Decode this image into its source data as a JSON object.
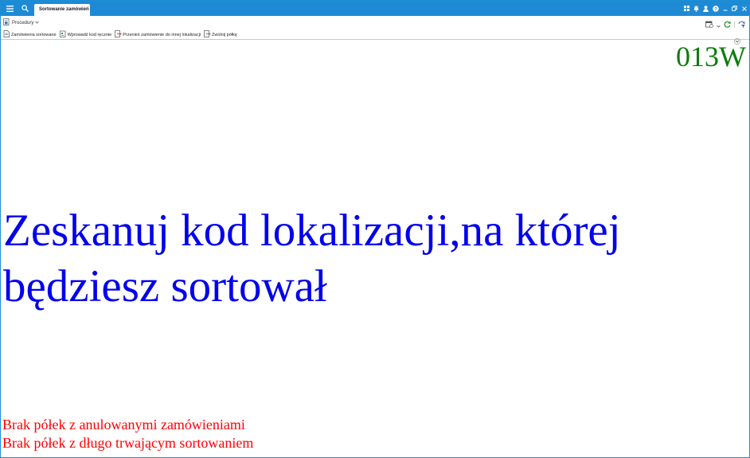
{
  "titlebar": {
    "tab_label": "Sortowanie zamówień",
    "icons": [
      "menu-icon",
      "search-icon",
      "apps-icon",
      "bell-icon",
      "user-icon",
      "help-icon",
      "minimize-icon",
      "restore-icon",
      "close-icon"
    ]
  },
  "ribbon": {
    "procedures_label": "Procedury"
  },
  "toolbar": {
    "items": [
      {
        "label": "Zamówienia sortowane"
      },
      {
        "label": "Wprowadź kod ręcznie"
      },
      {
        "label": "Przenieś zamówienie do innej lokalizacji"
      },
      {
        "label": "Zwolnij półkę"
      }
    ]
  },
  "content": {
    "counter": "013W",
    "message": "Zeskanuj kod lokalizacji,na której będziesz sortował",
    "status_lines": [
      "Brak półek z anulowanymi zamówieniami",
      "Brak półek z długo trwającym sortowaniem"
    ]
  },
  "colors": {
    "titlebar": "#1e8ad6",
    "counter": "#0a7d0a",
    "message": "#0000ee",
    "status": "#ff0000"
  }
}
